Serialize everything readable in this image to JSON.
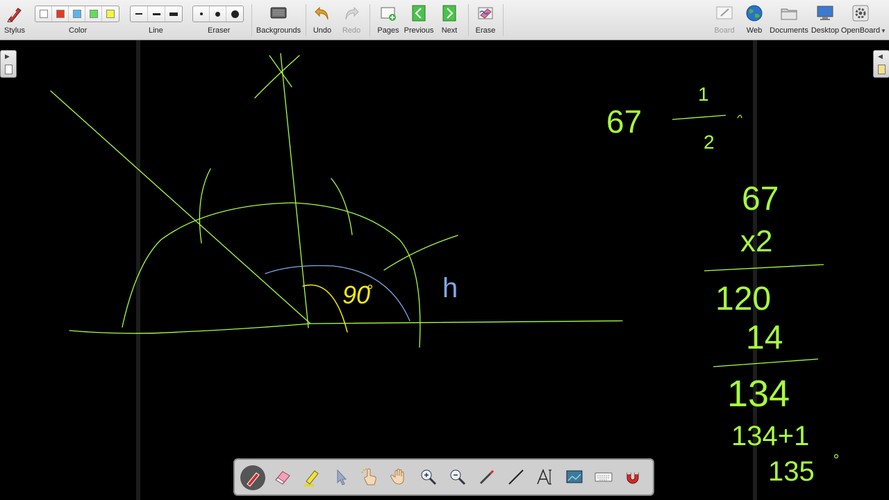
{
  "toolbar": {
    "stylus": "Stylus",
    "color": "Color",
    "line": "Line",
    "eraser": "Eraser",
    "backgrounds": "Backgrounds",
    "undo": "Undo",
    "redo": "Redo",
    "pages": "Pages",
    "previous": "Previous",
    "next": "Next",
    "erase": "Erase",
    "board": "Board",
    "web": "Web",
    "documents": "Documents",
    "desktop": "Desktop",
    "openboard": "OpenBoard"
  },
  "colors": {
    "swatches": [
      "#ffffff",
      "#e53a1e",
      "#5ab4f0",
      "#5de05a",
      "#f5f53a"
    ],
    "ink_green": "#a8ff3c",
    "ink_yellow": "#f5f000",
    "ink_blue": "#7fa8e8"
  },
  "board": {
    "angle_label": "90",
    "letter_h": "h",
    "fraction_whole": "67",
    "fraction_num": "1",
    "fraction_den": "2",
    "calc_line1": "67",
    "calc_line2": "x2",
    "calc_line3": "120",
    "calc_line4": "14",
    "calc_line5": "134",
    "calc_line6": "134+1",
    "calc_line7": "135"
  },
  "palette": {
    "tools": [
      "pen-tool",
      "eraser-tool",
      "marker-tool",
      "selector-tool",
      "interact-tool",
      "hand-tool",
      "zoom-in-tool",
      "zoom-out-tool",
      "laser-pointer-tool",
      "line-tool",
      "text-tool",
      "capture-tool",
      "keyboard-tool",
      "magnet-tool"
    ],
    "active": "pen-tool"
  }
}
